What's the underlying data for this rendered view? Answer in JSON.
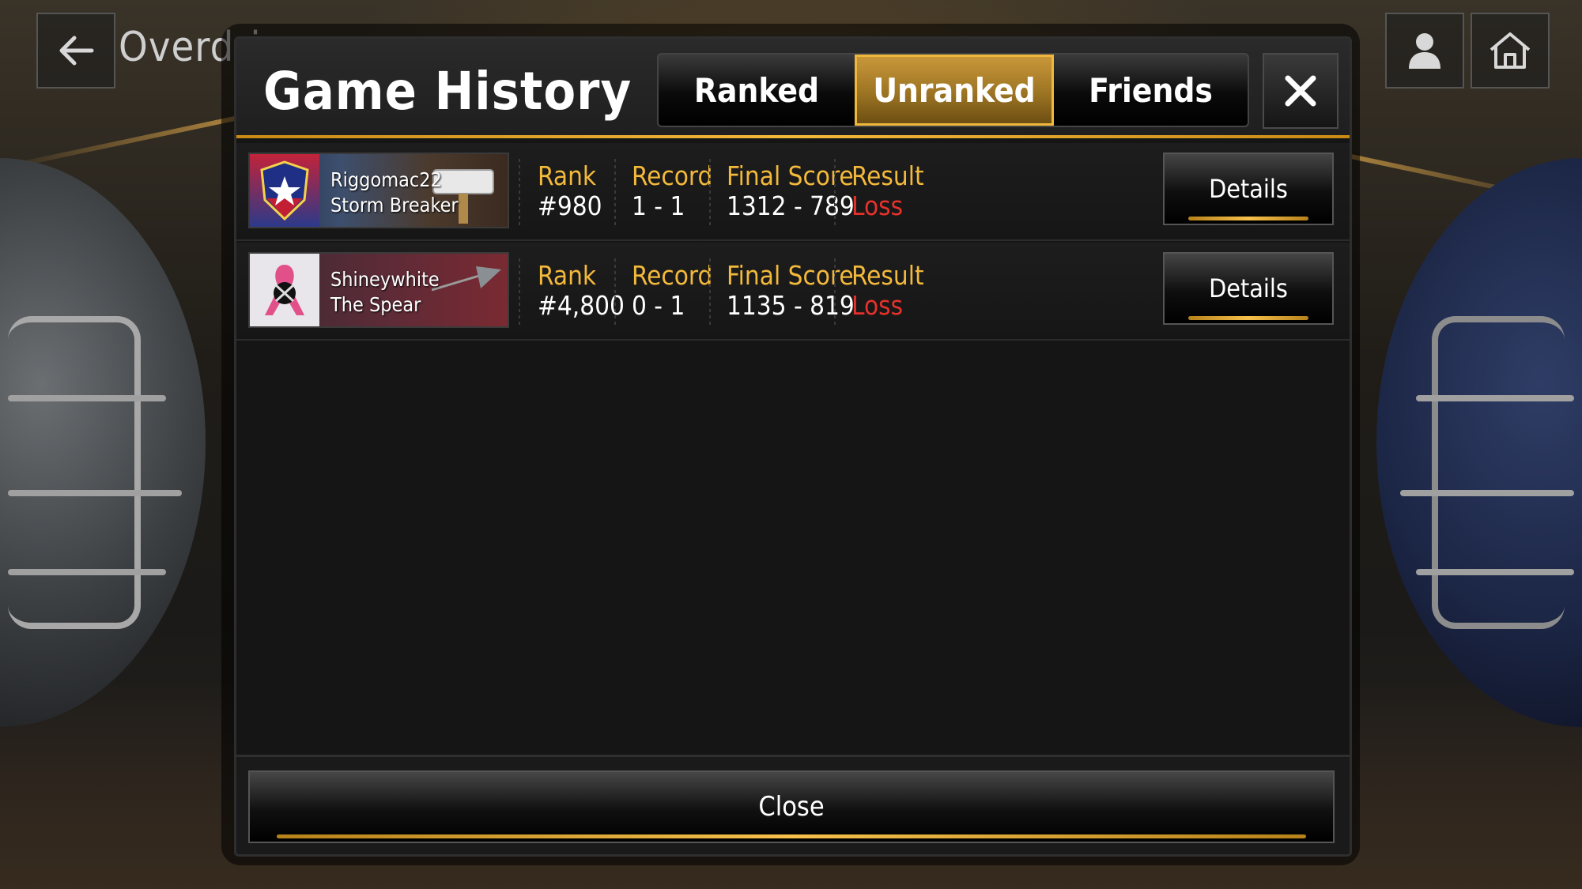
{
  "page": {
    "title": "Overdriv"
  },
  "icons": {
    "back": "back-arrow-icon",
    "profile": "profile-icon",
    "home": "home-icon",
    "close": "close-icon"
  },
  "modal": {
    "title": "Game History",
    "tabs": [
      {
        "label": "Ranked",
        "active": false
      },
      {
        "label": "Unranked",
        "active": true
      },
      {
        "label": "Friends",
        "active": false
      }
    ],
    "stat_labels": {
      "rank": "Rank",
      "record": "Record",
      "final_score": "Final Score",
      "result": "Result"
    },
    "matches": [
      {
        "player": "Riggomac22",
        "banner_title": "Storm Breaker",
        "rank": "#980",
        "record": "1 - 1",
        "final_score": "1312 - 789",
        "result": "Loss",
        "details_label": "Details"
      },
      {
        "player": "Shineywhite",
        "banner_title": "The Spear",
        "rank": "#4,800",
        "record": "0 - 1",
        "final_score": "1135 - 819",
        "result": "Loss",
        "details_label": "Details"
      }
    ],
    "close_label": "Close"
  },
  "colors": {
    "accent": "#f3b93b",
    "loss": "#e8312b"
  }
}
